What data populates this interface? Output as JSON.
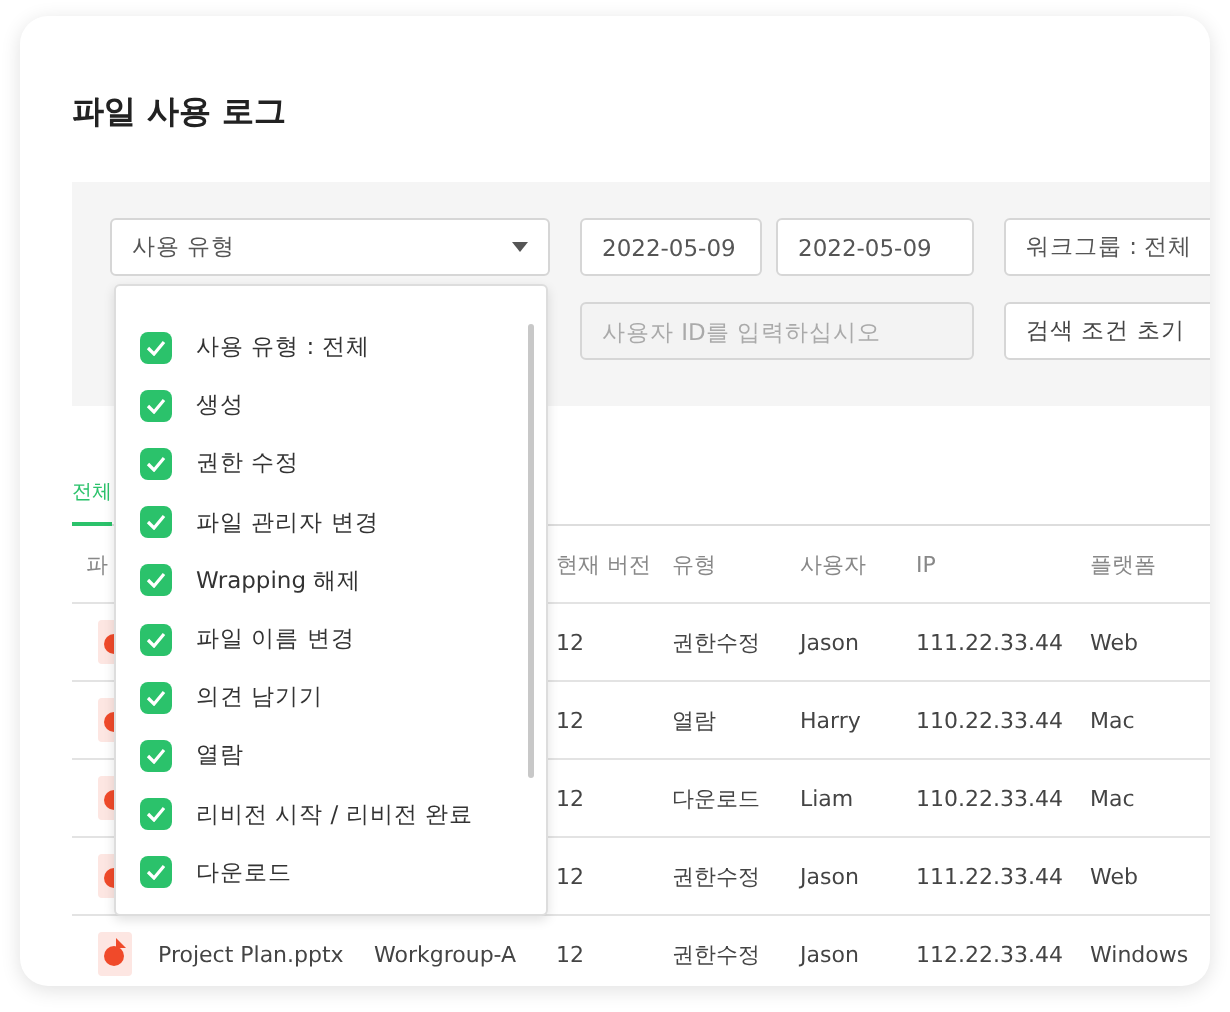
{
  "title": "파일 사용 로그",
  "filters": {
    "usage_type": {
      "value": "사용 유형",
      "expanded": true
    },
    "date_from": {
      "value": "2022-05-09"
    },
    "date_to": {
      "value": "2022-05-09"
    },
    "workgroup": {
      "value": "워크그룹 : 전체"
    },
    "user_id": {
      "placeholder": "사용자 ID를 입력하십시오"
    },
    "reset_button": "검색 조건 초기"
  },
  "usage_type_options": [
    {
      "label": "사용 유형 : 전체",
      "checked": true
    },
    {
      "label": "생성",
      "checked": true
    },
    {
      "label": "권한 수정",
      "checked": true
    },
    {
      "label": "파일 관리자 변경",
      "checked": true
    },
    {
      "label": "Wrapping 해제",
      "checked": true
    },
    {
      "label": "파일 이름 변경",
      "checked": true
    },
    {
      "label": "의견 남기기",
      "checked": true
    },
    {
      "label": "열람",
      "checked": true
    },
    {
      "label": "리비전 시작 / 리비전 완료",
      "checked": true
    },
    {
      "label": "다운로드",
      "checked": true
    }
  ],
  "tabs": [
    {
      "label": "전체",
      "selected": true
    }
  ],
  "table": {
    "columns": [
      "파",
      "",
      "",
      "현재 버전",
      "유형",
      "사용자",
      "IP",
      "플랫폼"
    ],
    "rows": [
      {
        "version": "12",
        "type": "권한수정",
        "user": "Jason",
        "ip": "111.22.33.44",
        "platform": "Web"
      },
      {
        "version": "12",
        "type": "열람",
        "user": "Harry",
        "ip": "110.22.33.44",
        "platform": "Mac"
      },
      {
        "version": "12",
        "type": "다운로드",
        "user": "Liam",
        "ip": "110.22.33.44",
        "platform": "Mac"
      },
      {
        "version": "12",
        "type": "권한수정",
        "user": "Jason",
        "ip": "111.22.33.44",
        "platform": "Web"
      },
      {
        "file": "Project Plan.pptx",
        "workgroup": "Workgroup-A",
        "version": "12",
        "type": "권한수정",
        "user": "Jason",
        "ip": "112.22.33.44",
        "platform": "Windows"
      }
    ]
  }
}
